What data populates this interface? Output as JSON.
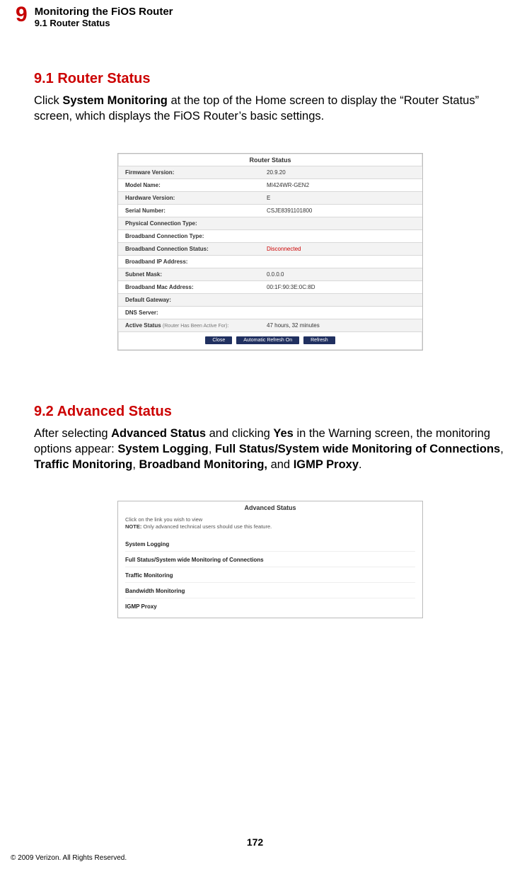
{
  "header": {
    "chapter_num": "9",
    "chapter_title": "Monitoring the FiOS Router",
    "section_head": "9.1  Router Status"
  },
  "sec91": {
    "title": "9.1  Router Status",
    "p_pre": "Click ",
    "p_bold": "System Monitoring",
    "p_post": " at the top of the Home screen to display the “Router Status” screen, which displays the FiOS Router’s basic settings."
  },
  "router_status": {
    "title": "Router Status",
    "rows": [
      {
        "label": "Firmware Version:",
        "value": "20.9.20"
      },
      {
        "label": "Model Name:",
        "value": "MI424WR-GEN2"
      },
      {
        "label": "Hardware Version:",
        "value": "E"
      },
      {
        "label": "Serial Number:",
        "value": "CSJE8391101800"
      },
      {
        "label": "Physical Connection Type:",
        "value": ""
      },
      {
        "label": "Broadband Connection Type:",
        "value": ""
      },
      {
        "label": "Broadband Connection Status:",
        "value": "Disconnected",
        "red": true
      },
      {
        "label": "Broadband IP Address:",
        "value": ""
      },
      {
        "label": "Subnet Mask:",
        "value": "0.0.0.0"
      },
      {
        "label": "Broadband Mac Address:",
        "value": "00:1F:90:3E:0C:8D"
      },
      {
        "label": "Default Gateway:",
        "value": ""
      },
      {
        "label": "DNS Server:",
        "value": ""
      },
      {
        "label": "Active Status",
        "small": "(Router Has Been Active For):",
        "value": "47 hours, 32 minutes"
      }
    ],
    "buttons": [
      "Close",
      "Automatic Refresh On",
      "Refresh"
    ]
  },
  "sec92": {
    "title": "9.2  Advanced Status",
    "p1": "After selecting ",
    "b1": "Advanced Status",
    "p2": " and clicking ",
    "b2": "Yes",
    "p3": " in the Warning screen, the monitoring options appear: ",
    "b3": "System Logging",
    "c1": ", ",
    "b4": "Full Status/System wide Monitoring of Connections",
    "c2": ", ",
    "b5": "Traffic Monitoring",
    "c3": ", ",
    "b6": "Broadband Monitoring,",
    "p4": " and ",
    "b7": "IGMP Proxy",
    "p5": "."
  },
  "adv_status": {
    "title": "Advanced Status",
    "note_pre": "Click on the link you wish to view",
    "note_bold": "NOTE:",
    "note_post": " Only advanced technical users should use this feature.",
    "links": [
      "System Logging",
      "Full Status/System wide Monitoring of Connections",
      "Traffic Monitoring",
      "Bandwidth Monitoring",
      "IGMP Proxy"
    ]
  },
  "footer": {
    "page_num": "172",
    "copyright": "© 2009 Verizon. All Rights Reserved."
  }
}
